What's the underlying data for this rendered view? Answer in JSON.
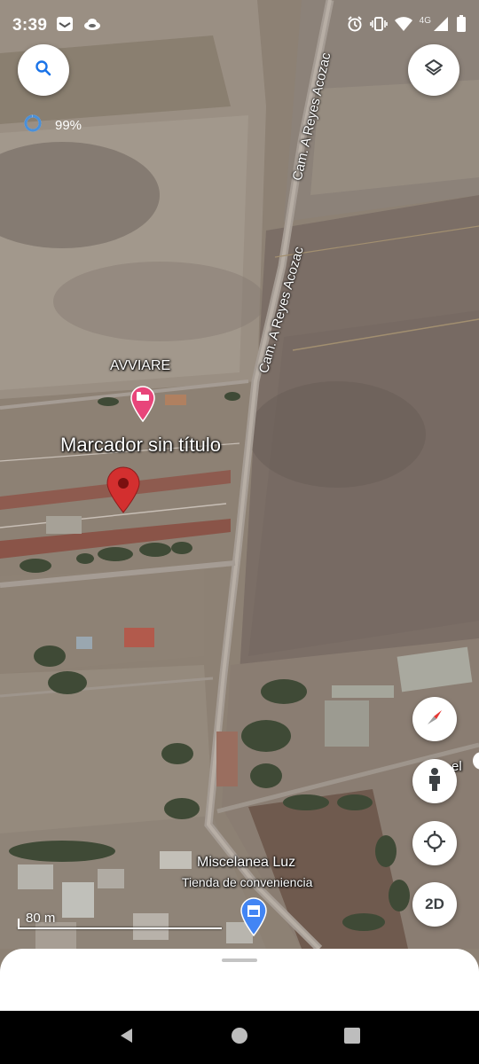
{
  "status_bar": {
    "time": "3:39",
    "battery_icon": "battery-icon",
    "network_type": "4G",
    "icons": [
      "mail-icon",
      "cloud-icon",
      "alarm-icon",
      "vibrate-icon",
      "wifi-icon",
      "signal-icon",
      "battery-icon"
    ]
  },
  "map": {
    "loading_percent": "99%",
    "roads": {
      "upper": "Cam. A Reyes Acozac",
      "lower": "Cam. A Reyes Acozac"
    },
    "places": {
      "hotel_name": "AVVIARE",
      "marker_title": "Marcador sin título",
      "store_name": "Miscelanea Luz",
      "store_category": "Tienda de conveniencia",
      "partial_label": "el"
    },
    "scale_label": "80 m",
    "colors": {
      "marker_red": "#d32f2f",
      "hotel_pin": "#e8457a",
      "store_pin": "#4285f4",
      "loading_ring": "#4a90d9"
    }
  },
  "controls": {
    "search_icon": "search-icon",
    "layers_icon": "layers-icon",
    "compass_icon": "compass-icon",
    "pegman_icon": "pegman-icon",
    "location_icon": "my-location-icon",
    "mode_label": "2D"
  },
  "nav": {
    "back_icon": "back-icon",
    "home_icon": "home-icon",
    "recents_icon": "recents-icon"
  }
}
